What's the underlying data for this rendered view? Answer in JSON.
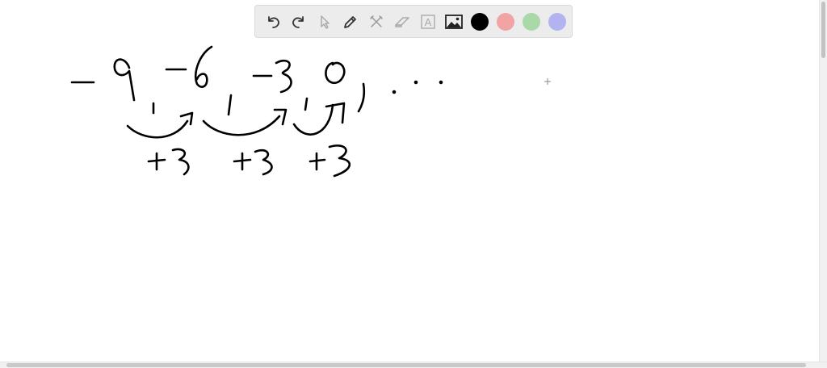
{
  "toolbar": {
    "tools": [
      {
        "name": "undo-icon"
      },
      {
        "name": "redo-icon"
      },
      {
        "name": "select-pointer-icon"
      },
      {
        "name": "pen-icon"
      },
      {
        "name": "tools-icon"
      },
      {
        "name": "eraser-icon"
      },
      {
        "name": "text-tool-icon",
        "label": "A"
      },
      {
        "name": "image-icon"
      }
    ],
    "colors": [
      "#000000",
      "#f2a4a4",
      "#a9d8a9",
      "#b3b3f0"
    ]
  },
  "ink": {
    "color": "#000000"
  }
}
